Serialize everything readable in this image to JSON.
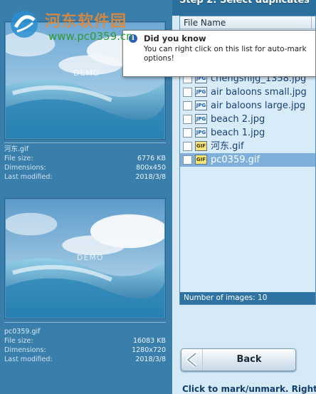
{
  "step_title": "Step 2: Select duplicates",
  "previews": [
    {
      "image_caption": "DEMO",
      "filename": "河东.gif",
      "file_size_label": "File size:",
      "file_size": "6776 KB",
      "dimensions_label": "Dimensions:",
      "dimensions": "800x450",
      "modified_label": "Last modified:",
      "modified": "2018/3/8"
    },
    {
      "image_caption": "DEMO",
      "filename": "pc0359.gif",
      "file_size_label": "File size:",
      "file_size": "16083 KB",
      "dimensions_label": "Dimensions:",
      "dimensions": "1280x720",
      "modified_label": "Last modified:",
      "modified": "2018/3/8"
    }
  ],
  "list": {
    "column_header": "File Name",
    "items": [
      {
        "type": "JPG",
        "name": "chengshijg_1358.jpg",
        "selected": false
      },
      {
        "type": "JPG",
        "name": "air baloons small.jpg",
        "selected": false
      },
      {
        "type": "JPG",
        "name": "air baloons large.jpg",
        "selected": false
      },
      {
        "type": "JPG",
        "name": "beach 2.jpg",
        "selected": false
      },
      {
        "type": "JPG",
        "name": "beach 1.jpg",
        "selected": false
      },
      {
        "type": "GIF",
        "name": "河东.gif",
        "selected": false
      },
      {
        "type": "GIF",
        "name": "pc0359.gif",
        "selected": true
      }
    ],
    "count_text": "Number of images: 10"
  },
  "tooltip": {
    "icon": "info-icon",
    "title": "Did you know",
    "body": "You can right click on this list for auto-mark options!"
  },
  "back_button": {
    "label": "Back",
    "icon": "back-arrow-icon"
  },
  "status_text": "Click to mark/unmark. Right",
  "watermark": {
    "name": "河东软件园",
    "url": "www.pc0359.cn"
  },
  "colors": {
    "panel": "#3a7eab",
    "list_bg": "#d7ebf8",
    "selected_row": "#7fb0dc",
    "count_bar": "#2f73a2"
  }
}
